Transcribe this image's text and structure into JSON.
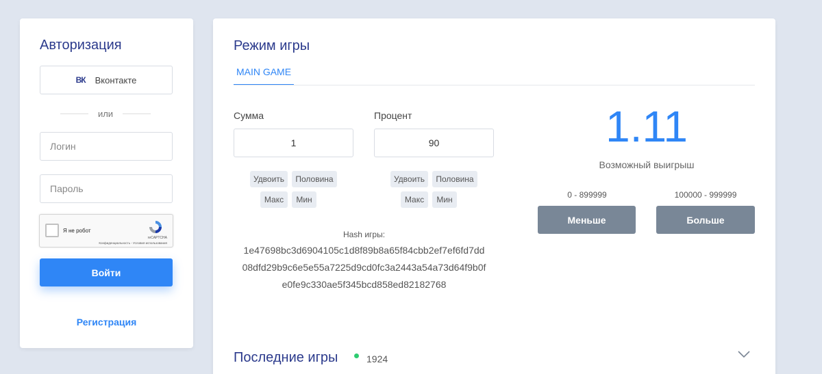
{
  "auth": {
    "title": "Авторизация",
    "vk_icon": "ВК",
    "vk_label": "Вконтакте",
    "or_text": "или",
    "login_placeholder": "Логин",
    "password_placeholder": "Пароль",
    "captcha": {
      "label": "Я не робот",
      "brand": "reCAPTCHA",
      "links": "Конфиденциальность - Условия использования"
    },
    "submit_label": "Войти",
    "register_label": "Регистрация"
  },
  "game": {
    "title": "Режим игры",
    "tabs": [
      {
        "label": "MAIN GAME",
        "active": true
      }
    ],
    "sum": {
      "label": "Сумма",
      "value": "1"
    },
    "percent": {
      "label": "Процент",
      "value": "90"
    },
    "chips": {
      "double": "Удвоить",
      "half": "Половина",
      "max": "Макс",
      "min": "Мин"
    },
    "hash": {
      "label": "Hash игры:",
      "lines": [
        "1e47698bc3d6904105c1d8f89b8a65f84cbb2ef7ef6fd7dd",
        "08dfd29b9c6e5e55a7225d9cd0fc3a2443a54a73d64f9b0f",
        "e0fe9c330ae5f345bcd858ed82182768"
      ]
    },
    "possible_win": {
      "value": "1.11",
      "label": "Возможный выигрыш"
    },
    "less": {
      "range": "0 - 899999",
      "label": "Меньше"
    },
    "more": {
      "range": "100000 - 999999",
      "label": "Больше"
    }
  },
  "last_games": {
    "title": "Последние игры",
    "online_count": "1924",
    "icon": "chevron-down-icon"
  },
  "colors": {
    "background": "#dfe5ef",
    "accent": "#2f86f6",
    "title": "#2b3a8c",
    "bet_button": "#798797",
    "online": "#2ecc71"
  }
}
